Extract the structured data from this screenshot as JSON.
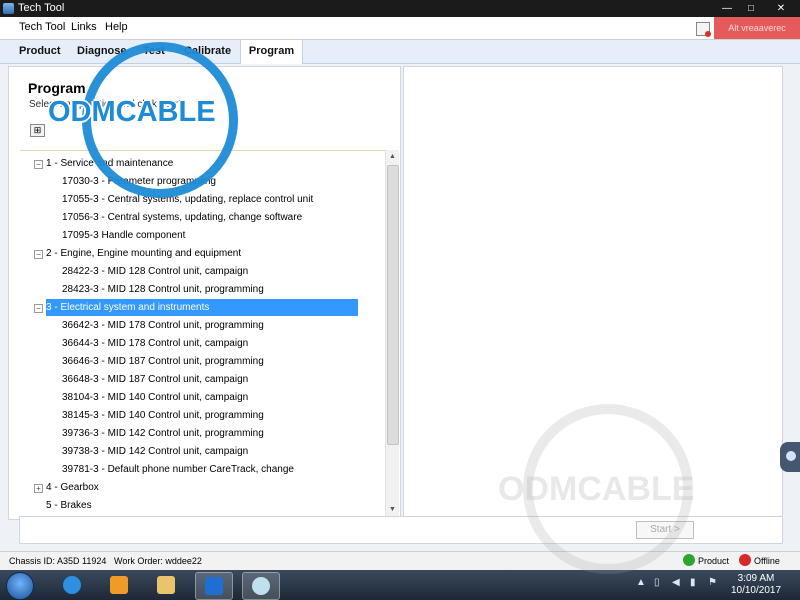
{
  "window": {
    "title": "Tech Tool",
    "controls": [
      "—",
      "□",
      "✕"
    ]
  },
  "menu": {
    "items": [
      "Tech Tool",
      "Links",
      "Help"
    ]
  },
  "alert": {
    "label": "Alt vreaaverec",
    "color": "#e55a5a"
  },
  "tabs": [
    {
      "label": "Product",
      "active": false
    },
    {
      "label": "Diagnose",
      "active": false
    },
    {
      "label": "Test",
      "active": false
    },
    {
      "label": "Calibrate",
      "active": false
    },
    {
      "label": "Program",
      "active": true
    }
  ],
  "panel": {
    "title": "Program",
    "subtitle": "Select an operation and click Start",
    "expand_glyph": "⊞"
  },
  "tree": {
    "groups": [
      {
        "label": "1 - Service and maintenance",
        "expanded": true,
        "items": [
          "17030-3 - Parameter programming",
          "17055-3 - Central systems, updating, replace control unit",
          "17056-3 - Central systems, updating, change software",
          "17095-3 Handle component"
        ]
      },
      {
        "label": "2 - Engine, Engine mounting and equipment",
        "expanded": true,
        "items": [
          "28422-3 - MID 128 Control unit, campaign",
          "28423-3 - MID 128 Control unit, programming"
        ]
      },
      {
        "label": "3 - Electrical system and instruments",
        "expanded": true,
        "selected": true,
        "items": [
          "36642-3 - MID 178 Control unit, programming",
          "36644-3 - MID 178 Control unit, campaign",
          "36646-3 - MID 187 Control unit, programming",
          "36648-3 - MID 187 Control unit, campaign",
          "38104-3 - MID 140 Control unit, campaign",
          "38145-3 - MID 140 Control unit, programming",
          "39736-3 - MID 142 Control unit, programming",
          "39738-3 - MID 142 Control unit, campaign",
          "39781-3 - Default phone number CareTrack, change"
        ]
      },
      {
        "label": "4 - Gearbox",
        "expanded": false,
        "items": []
      },
      {
        "label": "5 - Brakes",
        "expanded": false,
        "items": []
      }
    ],
    "selected_color": "#3399ff"
  },
  "start_button": {
    "label": "Start >"
  },
  "status": {
    "chassis_id": "Chassis ID: A35D 11924",
    "work_order": "Work Order: wddee22",
    "product": "Product",
    "offline": "Offline",
    "product_color": "#2fa52f",
    "offline_color": "#d42a2a"
  },
  "taskbar": {
    "time": "3:09 AM",
    "date": "10/10/2017",
    "apps": [
      "internet-explorer",
      "media-player",
      "file-explorer",
      "teamviewer",
      "tech-tool"
    ]
  },
  "watermark": {
    "text": "ODMCABLE"
  }
}
